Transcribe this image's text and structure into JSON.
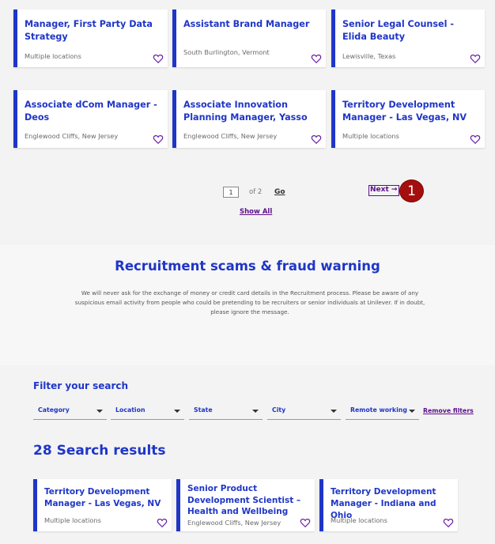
{
  "jobs_top": [
    {
      "title": "Manager, First Party Data Strategy",
      "location": "Multiple locations"
    },
    {
      "title": "Assistant Brand Manager",
      "location": "South Burlington, Vermont"
    },
    {
      "title": "Senior Legal Counsel - Elida Beauty",
      "location": "Lewisville, Texas"
    },
    {
      "title": "Associate dCom Manager - Deos",
      "location": "Englewood Cliffs, New Jersey"
    },
    {
      "title": "Associate Innovation Planning Manager, Yasso",
      "location": "Englewood Cliffs, New Jersey"
    },
    {
      "title": "Territory Development Manager - Las Vegas, NV",
      "location": "Multiple locations"
    }
  ],
  "pagination": {
    "page_value": "1",
    "of_text": "of 2",
    "go_label": "Go",
    "next_label": "Next",
    "show_all_label": "Show All"
  },
  "marker_number": "1",
  "scam": {
    "title": "Recruitment scams & fraud warning",
    "body": "We will never ask for the exchange of money or credit card details in the Recruitment process. Please be aware of any suspicious email activity from people who could be pretending to be recruiters or senior individuals at Unilever. If in doubt, please ignore the message."
  },
  "filters": {
    "label": "Filter your search",
    "dropdowns": [
      "Category",
      "Location",
      "State",
      "City",
      "Remote working"
    ],
    "remove_label": "Remove filters"
  },
  "results_title": "28 Search results",
  "jobs_bottom": [
    {
      "title": "Territory Development Manager - Las Vegas, NV",
      "location": "Multiple locations"
    },
    {
      "title": "Senior Product Development Scientist – Health and Wellbeing",
      "location": "Englewood Cliffs, New Jersey"
    },
    {
      "title": "Territory Development Manager - Indiana and Ohio",
      "location": "Multiple locations"
    }
  ],
  "colors": {
    "brand": "#1f36c7",
    "accent": "#5d0f8a",
    "marker": "#a40e0e"
  }
}
